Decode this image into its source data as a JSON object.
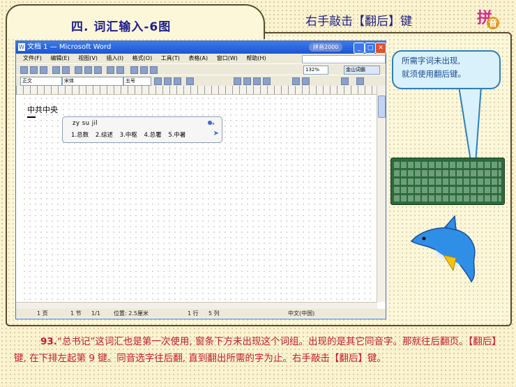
{
  "slide": {
    "title": "四. 词汇输入-6图",
    "subtitle": "右手敲击【翻后】键",
    "logo": {
      "char1": "拼",
      "char2": "音"
    }
  },
  "word": {
    "title": "文档 1 — Microsoft Word",
    "menu": [
      "文件(F)",
      "编辑(E)",
      "视图(V)",
      "插入(I)",
      "格式(O)",
      "工具(T)",
      "表格(A)",
      "窗口(W)",
      "帮助(H)"
    ],
    "zoom": "132%",
    "style_combo": "正文",
    "font_combo": "宋体",
    "size_combo": "五号",
    "jinshan_btn": "金山词霸",
    "doc_text": "中共中央",
    "ime": {
      "pinyin": "zy su jil",
      "candidates": [
        "1.总数",
        "2.综述",
        "3.中枢",
        "4.总署",
        "5.中暑"
      ]
    },
    "status": {
      "page": "1 页",
      "section": "1 节",
      "pages": "1/1",
      "position": "位置: 2.5厘米",
      "line": "1 行",
      "col": "5 列",
      "lang": "中文(中国)"
    }
  },
  "callout": {
    "line1": "所需字词未出现,",
    "line2": "就须使用翻后键。"
  },
  "caption": {
    "number": "93.",
    "text": "“总书记”这词汇也是第一次使用, 窗条下方未出现这个词组。出现的是其它同音字。那就往后翻页。【翻后】键, 在下排左起第 9 键。同音选字往后翻, 直到翻出所需的字为止。右手敲击【翻后】键。"
  }
}
